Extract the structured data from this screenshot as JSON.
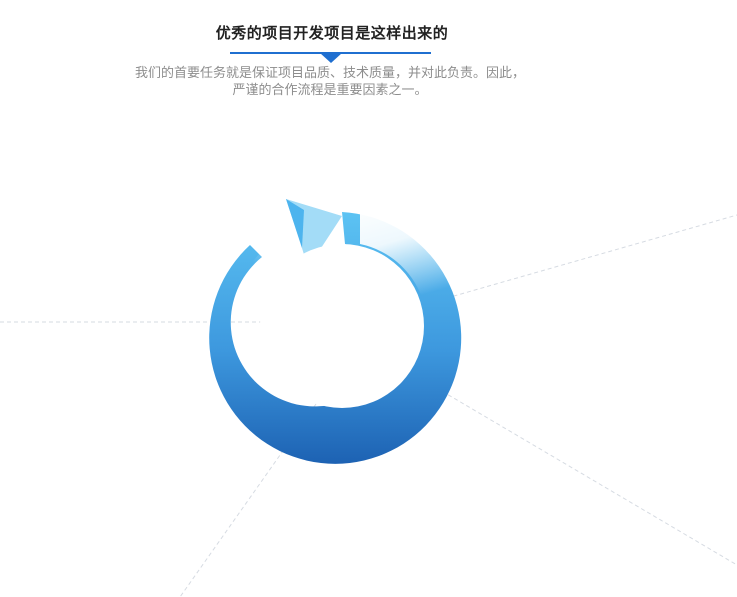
{
  "header": {
    "title": "优秀的项目开发项目是这样出来的",
    "description_line1": "我们的首要任务就是保证项目品质、技术质量，并对此负责。因此，",
    "description_line2": "严谨的合作流程是重要因素之一。"
  },
  "colors": {
    "accent": "#1f6fd0",
    "ring_light": "#58bff0",
    "ring_dark": "#1e66b5",
    "title_text": "#222222",
    "desc_text": "#8d8d8d"
  },
  "graphic": {
    "icon": "circular-arrow-icon"
  }
}
